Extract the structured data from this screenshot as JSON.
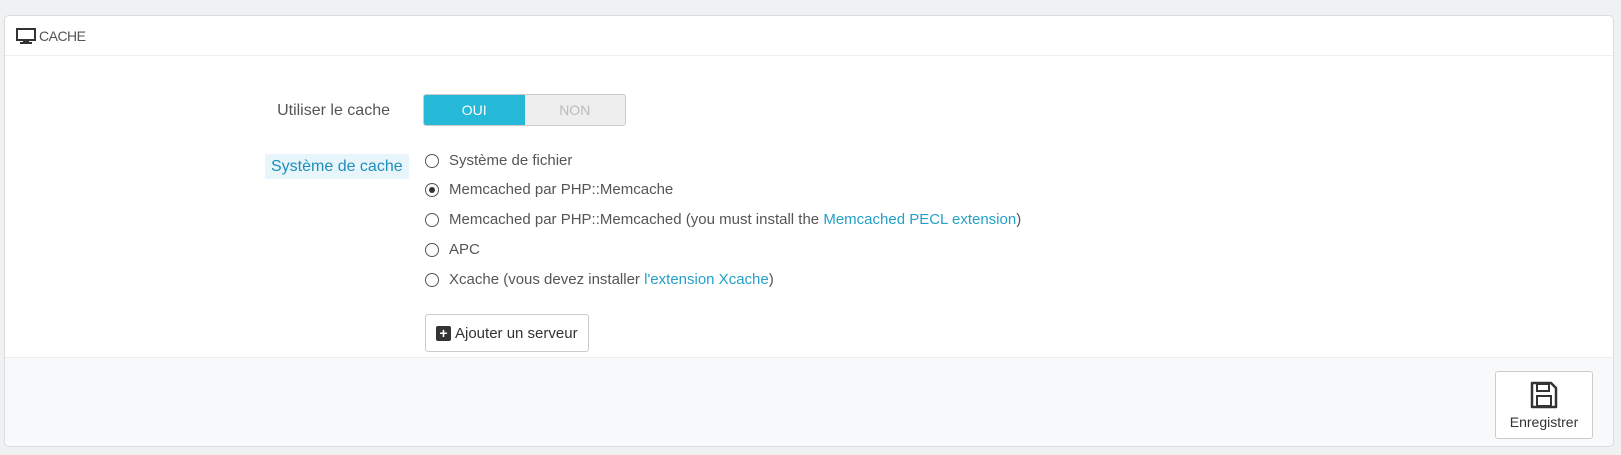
{
  "panel": {
    "title": "CACHE",
    "icon": "desktop-icon"
  },
  "use_cache": {
    "label": "Utiliser le cache",
    "on_label": "OUI",
    "off_label": "NON",
    "selected": "OUI"
  },
  "cache_system": {
    "label": "Système de cache",
    "options": [
      {
        "text": "Système de fichier",
        "checked": false
      },
      {
        "text": "Memcached par PHP::Memcache",
        "checked": true
      },
      {
        "text": "Memcached par PHP::Memcached (you must install the ",
        "link": "Memcached PECL extension",
        "suffix": ")",
        "checked": false
      },
      {
        "text": "APC",
        "checked": false
      },
      {
        "text": "Xcache (vous devez installer ",
        "link": "l'extension Xcache",
        "suffix": ")",
        "checked": false
      }
    ]
  },
  "add_server": {
    "label": "Ajouter un serveur",
    "icon": "plus-square-icon"
  },
  "footer": {
    "save_label": "Enregistrer",
    "save_icon": "floppy-disk-icon"
  },
  "colors": {
    "accent": "#25b9d7",
    "link": "#25a0c8",
    "label_highlight_bg": "#e8f5fb"
  }
}
